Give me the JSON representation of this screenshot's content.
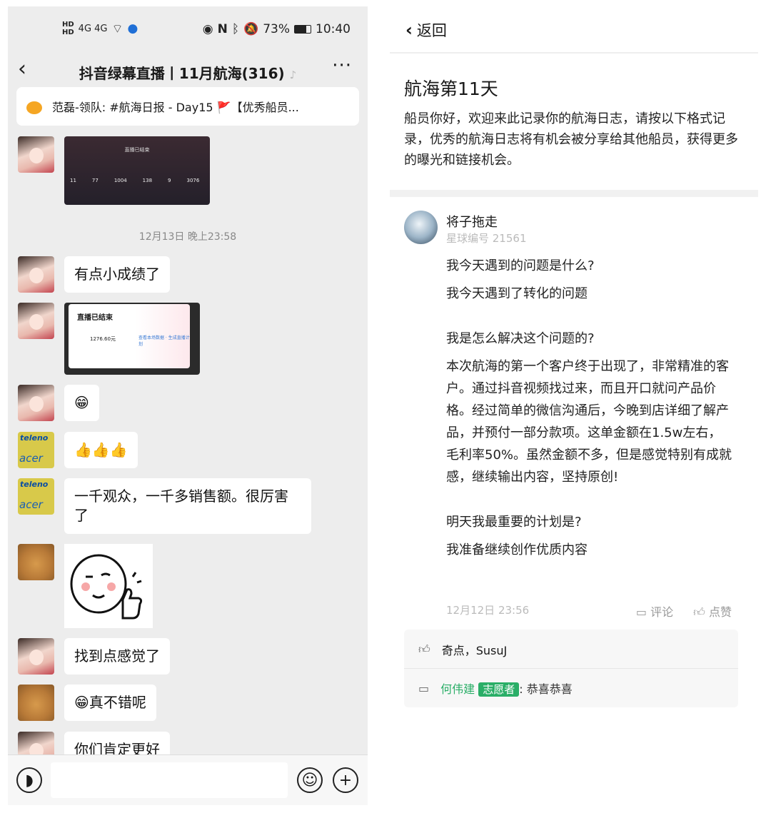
{
  "status": {
    "network": "4G 4G",
    "battery": "73%",
    "time": "10:40"
  },
  "chat": {
    "title": "抖音绿幕直播丨11月航海(316)",
    "more": "···",
    "pinned": "范磊-领队: #航海日报 - Day15 🚩【优秀船员...",
    "timestamp": "12月13日 晚上23:58",
    "screenshot1": {
      "title": "直播已结束",
      "stats": [
        "11",
        "77",
        "1004",
        "138",
        "9",
        "3076"
      ]
    },
    "screenshot2": {
      "title": "直播已结束",
      "amount": "1276.60元",
      "link": "查看本场数据 · 生成直播计划"
    },
    "messages": [
      {
        "text": "有点小成绩了"
      },
      {
        "text": "😁"
      },
      {
        "text": "👍👍👍"
      },
      {
        "text": "一千观众，一千多销售额。很厉害了"
      },
      {
        "text": "找到点感觉了"
      },
      {
        "text": "😁真不错呢"
      },
      {
        "text": "你们肯定更好"
      }
    ],
    "avatar_acer": {
      "brand": "teleno",
      "sub": "acer"
    }
  },
  "detail": {
    "back": "返回",
    "title": "航海第11天",
    "intro": "船员你好，欢迎来此记录你的航海日志，请按以下格式记录，优秀的航海日志将有机会被分享给其他船员，获得更多的曝光和链接机会。",
    "author": "将子拖走",
    "member_no": "星球编号 21561",
    "q1": "我今天遇到的问题是什么?",
    "a1": "我今天遇到了转化的问题",
    "q2": "我是怎么解决这个问题的?",
    "a2": "本次航海的第一个客户终于出现了，非常精准的客户。通过抖音视频找过来，而且开口就问产品价格。经过简单的微信沟通后，今晚到店详细了解产品，并预付一部分款项。这单金额在1.5w左右，毛利率50%。虽然金额不多，但是感觉特别有成就感，继续输出内容，坚持原创!",
    "q3": "明天我最重要的计划是?",
    "a3": "我准备继续创作优质内容",
    "date": "12月12日 23:56",
    "comment_label": "评论",
    "like_label": "点赞",
    "likes": "奇点，SusuJ",
    "commenter": "何伟建",
    "badge": "志愿者",
    "comment": ": 恭喜恭喜"
  }
}
